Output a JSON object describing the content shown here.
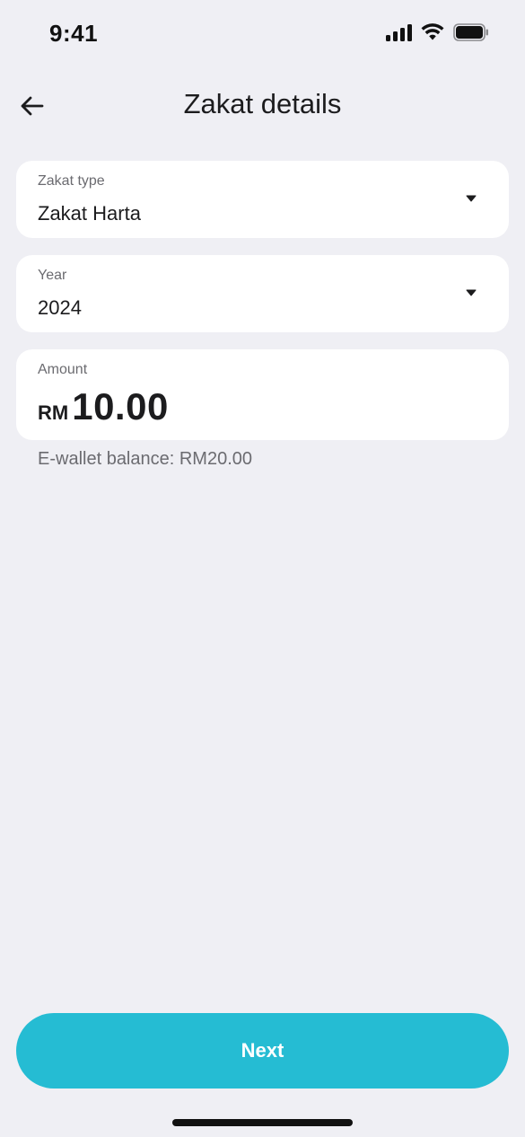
{
  "status_bar": {
    "time": "9:41"
  },
  "header": {
    "title": "Zakat details",
    "back_icon": "arrow-left-icon"
  },
  "zakat_type": {
    "label": "Zakat type",
    "value": "Zakat Harta"
  },
  "year": {
    "label": "Year",
    "value": "2024"
  },
  "amount": {
    "label": "Amount",
    "currency": "RM",
    "value": "10.00"
  },
  "balance_text": "E-wallet balance: RM20.00",
  "next_button": {
    "label": "Next"
  },
  "colors": {
    "background": "#efeff4",
    "card": "#ffffff",
    "accent": "#25bcd3",
    "text_primary": "#1c1c1e",
    "text_secondary": "#6b6b70"
  }
}
